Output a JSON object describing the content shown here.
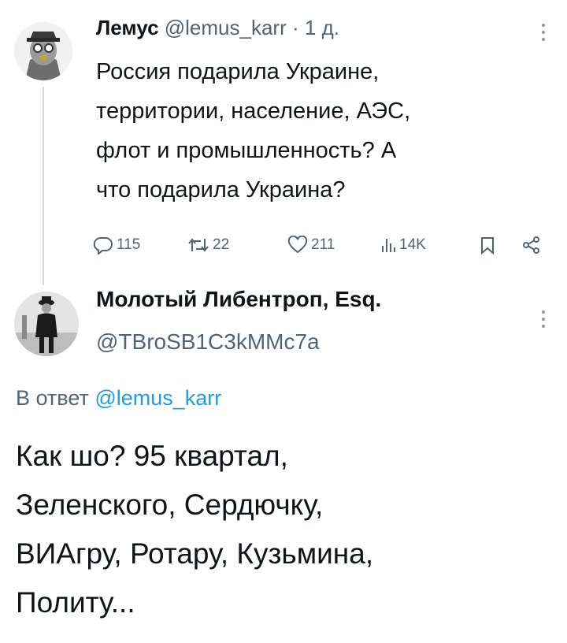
{
  "tweet1": {
    "author_name": "Лемус",
    "handle": "@lemus_karr",
    "separator": "·",
    "time": "1 д.",
    "lines": [
      "Россия подарила Украине,",
      "территории, население, АЭС,",
      "флот и промышленность? А",
      "что подарила Украина?"
    ],
    "actions": {
      "reply_count": "115",
      "retweet_count": "22",
      "like_count": "211",
      "views_count": "14K"
    }
  },
  "tweet2": {
    "author_name": "Молотый Либентроп, Esq.",
    "handle": "@TBroSB1C3kMMc7a",
    "reply_prefix": "В ответ",
    "reply_mention": "@lemus_karr",
    "lines": [
      "Как шо? 95 квартал,",
      "Зеленского, Сердючку,",
      "ВИАгру, Ротару, Кузьмина,",
      "Политу..."
    ]
  },
  "icons": {
    "reply": "reply-icon",
    "retweet": "retweet-icon",
    "like": "heart-icon",
    "views": "views-icon",
    "bookmark": "bookmark-icon",
    "share": "share-icon",
    "more": "more-vertical-icon"
  },
  "colors": {
    "text": "#0f1419",
    "secondary": "#536471",
    "link": "#1d9bf0",
    "divider": "#cfd9de"
  }
}
